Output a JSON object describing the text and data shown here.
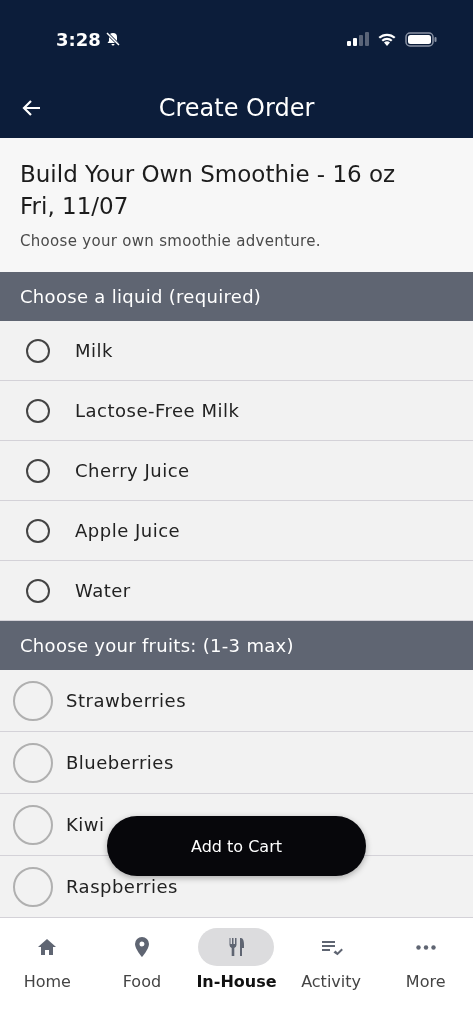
{
  "status_bar": {
    "time": "3:28",
    "silent": true
  },
  "header": {
    "title": "Create Order"
  },
  "intro": {
    "title": "Build Your Own Smoothie - 16 oz",
    "date": "Fri, 11/07",
    "description": "Choose your own smoothie adventure."
  },
  "sections": [
    {
      "title": "Choose a liquid (required)",
      "kind": "compact",
      "options": [
        {
          "label": "Milk",
          "selected": false
        },
        {
          "label": "Lactose-Free Milk",
          "selected": false
        },
        {
          "label": "Cherry Juice",
          "selected": false
        },
        {
          "label": "Apple Juice",
          "selected": false
        },
        {
          "label": "Water",
          "selected": false
        }
      ]
    },
    {
      "title": "Choose your fruits: (1-3 max)",
      "kind": "large",
      "options": [
        {
          "label": "Strawberries",
          "selected": false
        },
        {
          "label": "Blueberries",
          "selected": false
        },
        {
          "label": "Kiwi",
          "selected": false
        },
        {
          "label": "Raspberries",
          "selected": false
        }
      ]
    }
  ],
  "add_to_cart": {
    "label": "Add to Cart"
  },
  "nav": [
    {
      "label": "Home",
      "kind": "home",
      "selected": false
    },
    {
      "label": "Food",
      "kind": "pin",
      "selected": false
    },
    {
      "label": "In-House",
      "kind": "utensils",
      "selected": true
    },
    {
      "label": "Activity",
      "kind": "list",
      "selected": false
    },
    {
      "label": "More",
      "kind": "more",
      "selected": false
    }
  ]
}
